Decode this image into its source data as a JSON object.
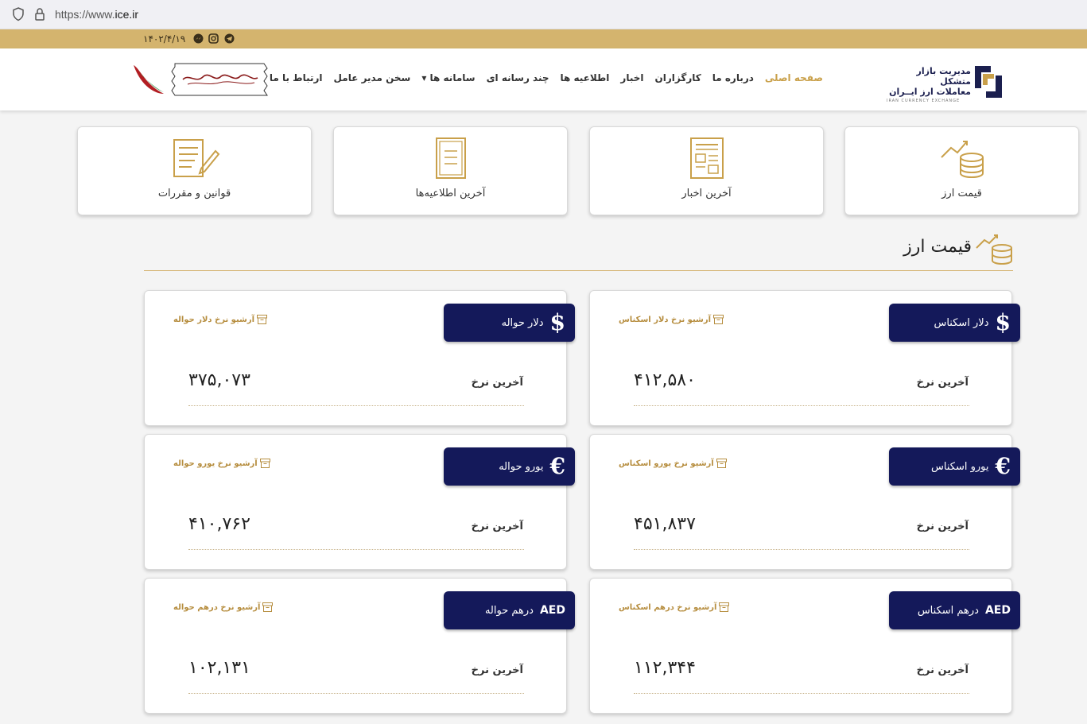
{
  "browser": {
    "url_prefix": "https://www.",
    "url_domain": "ice.ir"
  },
  "topbar": {
    "date": "۱۴۰۲/۴/۱۹",
    "social_icons": [
      "telegram-icon",
      "instagram-icon",
      "messenger-icon"
    ]
  },
  "header": {
    "logo_line1": "مدیریت بازار متشکل",
    "logo_line2": "معاملات ارز ایــران",
    "logo_line3": "IRAN CURRENCY EXCHANGE",
    "nav": [
      {
        "label": "صفحه اصلی",
        "active": true
      },
      {
        "label": "درباره ما"
      },
      {
        "label": "کارگزاران"
      },
      {
        "label": "اخبار"
      },
      {
        "label": "اطلاعیه ها"
      },
      {
        "label": "چند رسانه ای"
      },
      {
        "label": "سامانه ها ▾"
      },
      {
        "label": "سخن مدیر عامل"
      },
      {
        "label": "ارتباط با ما"
      }
    ]
  },
  "quick_links": [
    {
      "label": "قیمت ارز",
      "icon": "currency-price-icon"
    },
    {
      "label": "آخرین اخبار",
      "icon": "newspaper-icon"
    },
    {
      "label": "آخرین اطلاعیه‌ها",
      "icon": "announcement-icon"
    },
    {
      "label": "قوانین و مقررات",
      "icon": "regulations-icon"
    }
  ],
  "section": {
    "title": "قیمت ارز"
  },
  "rates": [
    {
      "name": "دلار اسکناس",
      "symbol": "$",
      "archive": "آرشیو نرخ دلار اسکناس",
      "last_label": "آخرین نرخ",
      "value": "۴۱۲,۵۸۰"
    },
    {
      "name": "دلار حواله",
      "symbol": "$",
      "archive": "آرشیو نرخ دلار حواله",
      "last_label": "آخرین نرخ",
      "value": "۳۷۵,۰۷۳"
    },
    {
      "name": "یورو اسکناس",
      "symbol": "€",
      "archive": "آرشیو نرخ یورو اسکناس",
      "last_label": "آخرین نرخ",
      "value": "۴۵۱,۸۳۷"
    },
    {
      "name": "یورو حواله",
      "symbol": "€",
      "archive": "آرشیو نرخ یورو حواله",
      "last_label": "آخرین نرخ",
      "value": "۴۱۰,۷۶۲"
    },
    {
      "name": "درهم اسکناس",
      "symbol": "AED",
      "archive": "آرشیو نرخ درهم اسکناس",
      "last_label": "آخرین نرخ",
      "value": "۱۱۲,۳۴۴"
    },
    {
      "name": "درهم حواله",
      "symbol": "AED",
      "archive": "آرشیو نرخ درهم حواله",
      "last_label": "آخرین نرخ",
      "value": "۱۰۲,۱۳۱"
    }
  ],
  "colors": {
    "gold": "#d4b46e",
    "navy": "#14195a",
    "active_nav": "#c9a04a"
  }
}
